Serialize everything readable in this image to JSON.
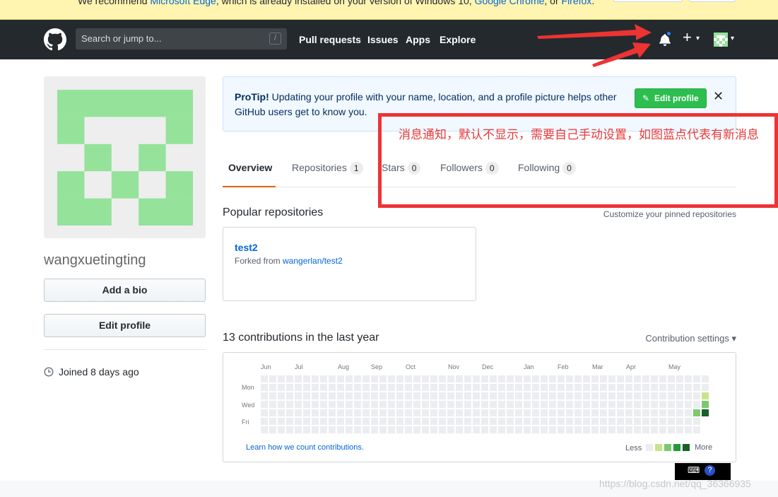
{
  "banner": {
    "text_before": "We recommend ",
    "edge": "Microsoft Edge",
    "text_mid": ", which is already installed on your version of Windows 10, ",
    "chrome": "Google Chrome",
    "text_or": ", or ",
    "firefox": "Firefox",
    "text_end": "."
  },
  "header": {
    "search_placeholder": "Search or jump to...",
    "search_key": "/",
    "nav": [
      "Pull requests",
      "Issues",
      "Apps",
      "Explore"
    ],
    "plus": "+",
    "caret": "▾",
    "notification_unread": true
  },
  "profile": {
    "username": "wangxuetingting",
    "add_bio": "Add a bio",
    "edit_profile": "Edit profile",
    "joined": "Joined 8 days ago",
    "identicon_color": "#95e29b"
  },
  "protip": {
    "label": "ProTip!",
    "text": " Updating your profile with your name, location, and a profile picture helps other GitHub users get to know you.",
    "button": "Edit profile",
    "close": "✕"
  },
  "tabs": [
    {
      "label": "Overview",
      "count": null,
      "selected": true
    },
    {
      "label": "Repositories",
      "count": "1"
    },
    {
      "label": "Stars",
      "count": "0"
    },
    {
      "label": "Followers",
      "count": "0"
    },
    {
      "label": "Following",
      "count": "0"
    }
  ],
  "popular": {
    "title": "Popular repositories",
    "customize": "Customize your pinned repositories",
    "repo_name": "test2",
    "forked_from_label": "Forked from ",
    "forked_from": "wangerlan/test2"
  },
  "contributions": {
    "title": "13 contributions in the last year",
    "settings": "Contribution settings ▾",
    "months": [
      "Jun",
      "Jul",
      "Aug",
      "Sep",
      "Oct",
      "Nov",
      "Dec",
      "Jan",
      "Feb",
      "Mar",
      "Apr",
      "May"
    ],
    "weekdays": [
      "Mon",
      "Wed",
      "Fri"
    ],
    "learn": "Learn how we count contributions.",
    "less": "Less",
    "more": "More",
    "colors": [
      "#ebedf0",
      "#c6e48b",
      "#7bc96f",
      "#239a3b",
      "#196127"
    ]
  },
  "annotation": {
    "text": "消息通知，默认不显示，需要自己手动设置，如图蓝点代表有新消息"
  },
  "watermark": "https://blog.csdn.net/qq_36366935"
}
